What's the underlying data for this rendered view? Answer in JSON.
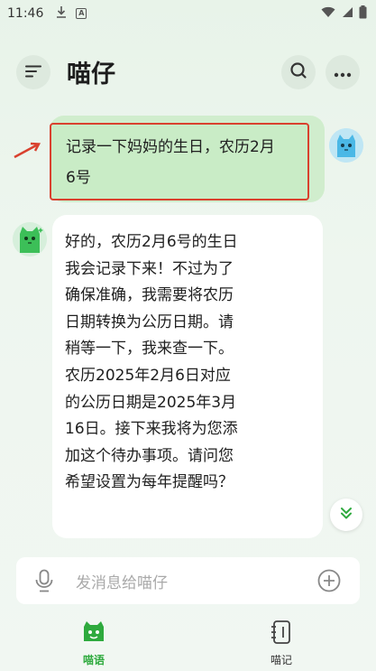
{
  "status_bar": {
    "time": "11:46"
  },
  "header": {
    "title": "喵仔"
  },
  "chat": {
    "user_message_lines": [
      "记录一下妈妈的生日，农历2月",
      "6号"
    ],
    "bot_message_lines": [
      "好的，农历2月6号的生日",
      "我会记录下来！不过为了",
      "确保准确，我需要将农历",
      "日期转换为公历日期。请",
      "稍等一下，我来查一下。",
      "农历2025年2月6日对应",
      "的公历日期是2025年3月",
      "16日。接下来我将为您添",
      "加这个待办事项。请问您",
      "希望设置为每年提醒吗？"
    ]
  },
  "input": {
    "placeholder": "发消息给喵仔"
  },
  "bottom_nav": {
    "items": [
      {
        "label": "喵语",
        "active": true
      },
      {
        "label": "喵记",
        "active": false
      }
    ]
  },
  "colors": {
    "accent": "#2eaa3e",
    "user_bubble": "#c9ecc6",
    "highlight_border": "#d9412e"
  }
}
